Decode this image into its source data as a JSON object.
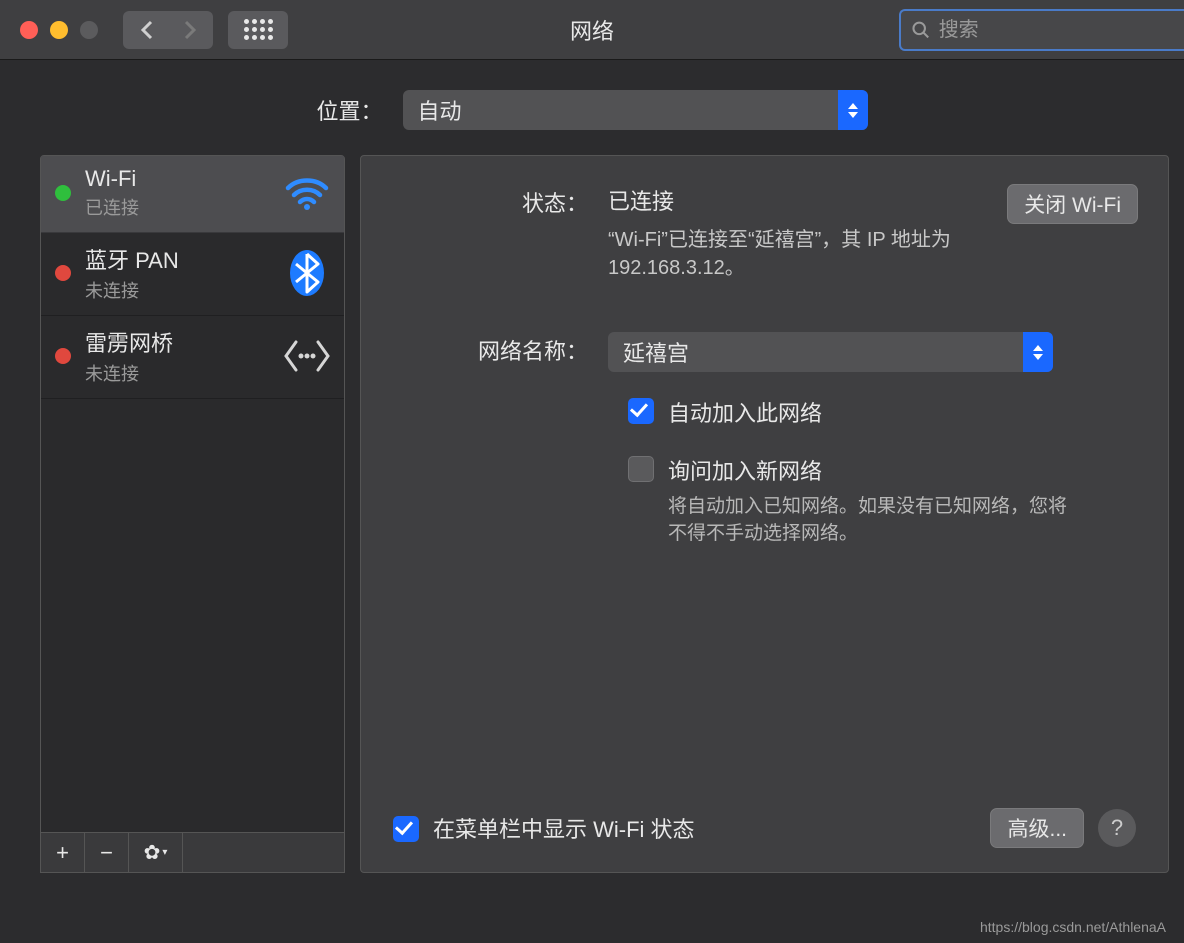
{
  "window": {
    "title": "网络"
  },
  "search": {
    "placeholder": "搜索"
  },
  "location": {
    "label": "位置：",
    "value": "自动"
  },
  "sidebar": {
    "items": [
      {
        "name": "Wi-Fi",
        "status": "已连接",
        "dot": "green",
        "icon": "wifi",
        "selected": true
      },
      {
        "name": "蓝牙 PAN",
        "status": "未连接",
        "dot": "red",
        "icon": "bluetooth",
        "selected": false
      },
      {
        "name": "雷雳网桥",
        "status": "未连接",
        "dot": "red",
        "icon": "thunderbolt-bridge",
        "selected": false
      }
    ],
    "footer": {
      "add": "+",
      "remove": "−",
      "gear": "⚙"
    }
  },
  "detail": {
    "status_label": "状态：",
    "status_value": "已连接",
    "status_desc": "“Wi-Fi”已连接至“延禧宫”，其 IP 地址为 192.168.3.12。",
    "wifi_off": "关闭 Wi-Fi",
    "netname_label": "网络名称：",
    "netname_value": "延禧宫",
    "auto_join": "自动加入此网络",
    "ask_join": "询问加入新网络",
    "ask_desc": "将自动加入已知网络。如果没有已知网络，您将不得不手动选择网络。",
    "menubar": "在菜单栏中显示 Wi-Fi 状态",
    "advanced": "高级...",
    "help": "?"
  },
  "watermark": "https://blog.csdn.net/AthlenaA"
}
